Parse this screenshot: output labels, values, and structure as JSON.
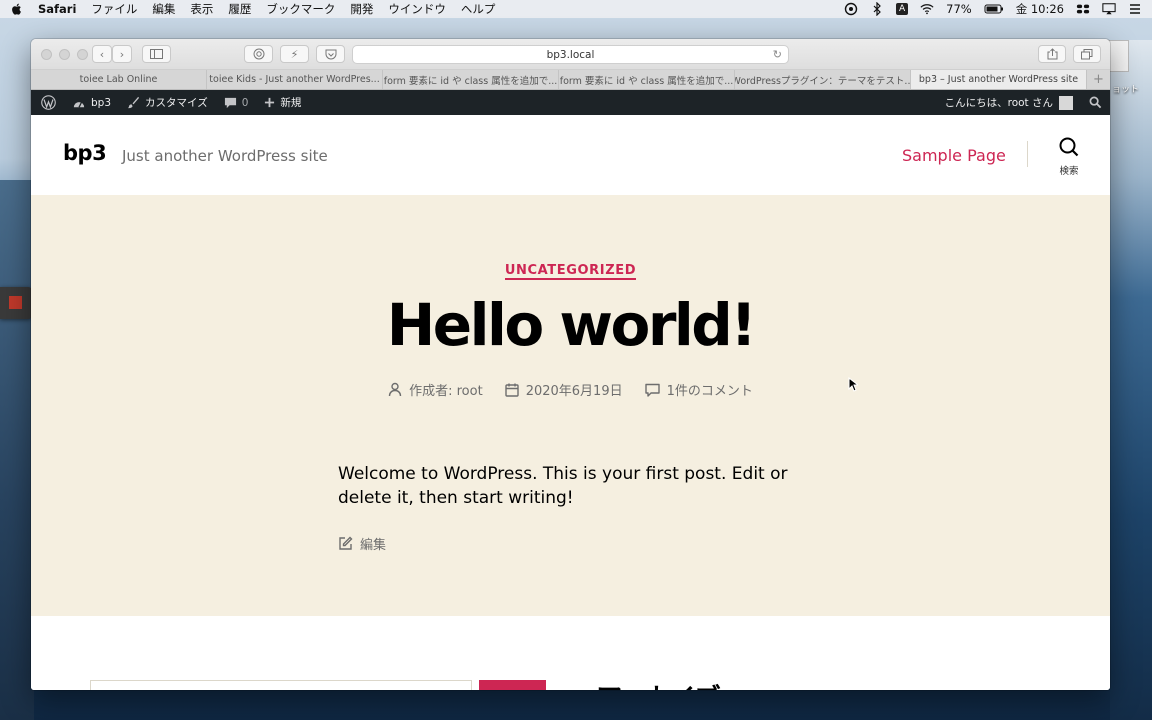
{
  "menubar": {
    "items": [
      "Safari",
      "ファイル",
      "編集",
      "表示",
      "履歴",
      "ブックマーク",
      "開発",
      "ウインドウ",
      "ヘルプ"
    ],
    "battery": "77%",
    "clock": "金 10:26",
    "input_indicator": "A"
  },
  "safari": {
    "url": "bp3.local",
    "tabs": [
      "toiee Lab Online",
      "toiee Kids - Just another WordPres...",
      "form 要素に id や class 属性を追加で...",
      "form 要素に id や class 属性を追加で...",
      "WordPressプラグイン：テーマをテスト...",
      "bp3 – Just another WordPress site"
    ],
    "add_tab": "+"
  },
  "adminbar": {
    "site": "bp3",
    "customize": "カスタマイズ",
    "comments_count": "0",
    "new": "新規",
    "greeting": "こんにちは、root さん"
  },
  "site": {
    "title": "bp3",
    "description": "Just another WordPress site",
    "nav_link": "Sample Page",
    "search_label": "検索"
  },
  "post": {
    "category": "UNCATEGORIZED",
    "title": "Hello world!",
    "author": "作成者: root",
    "date": "2020年6月19日",
    "comments": "1件のコメント",
    "content": "Welcome to WordPress. This is your first post. Edit or delete it, then start writing!",
    "edit": "編集"
  },
  "below": {
    "widget_title": "アーカイブ"
  },
  "desktop": {
    "label": "ョット"
  },
  "colors": {
    "accent": "#cd2653",
    "hero_bg": "#f5efe0",
    "adminbar_bg": "#1d2327"
  }
}
